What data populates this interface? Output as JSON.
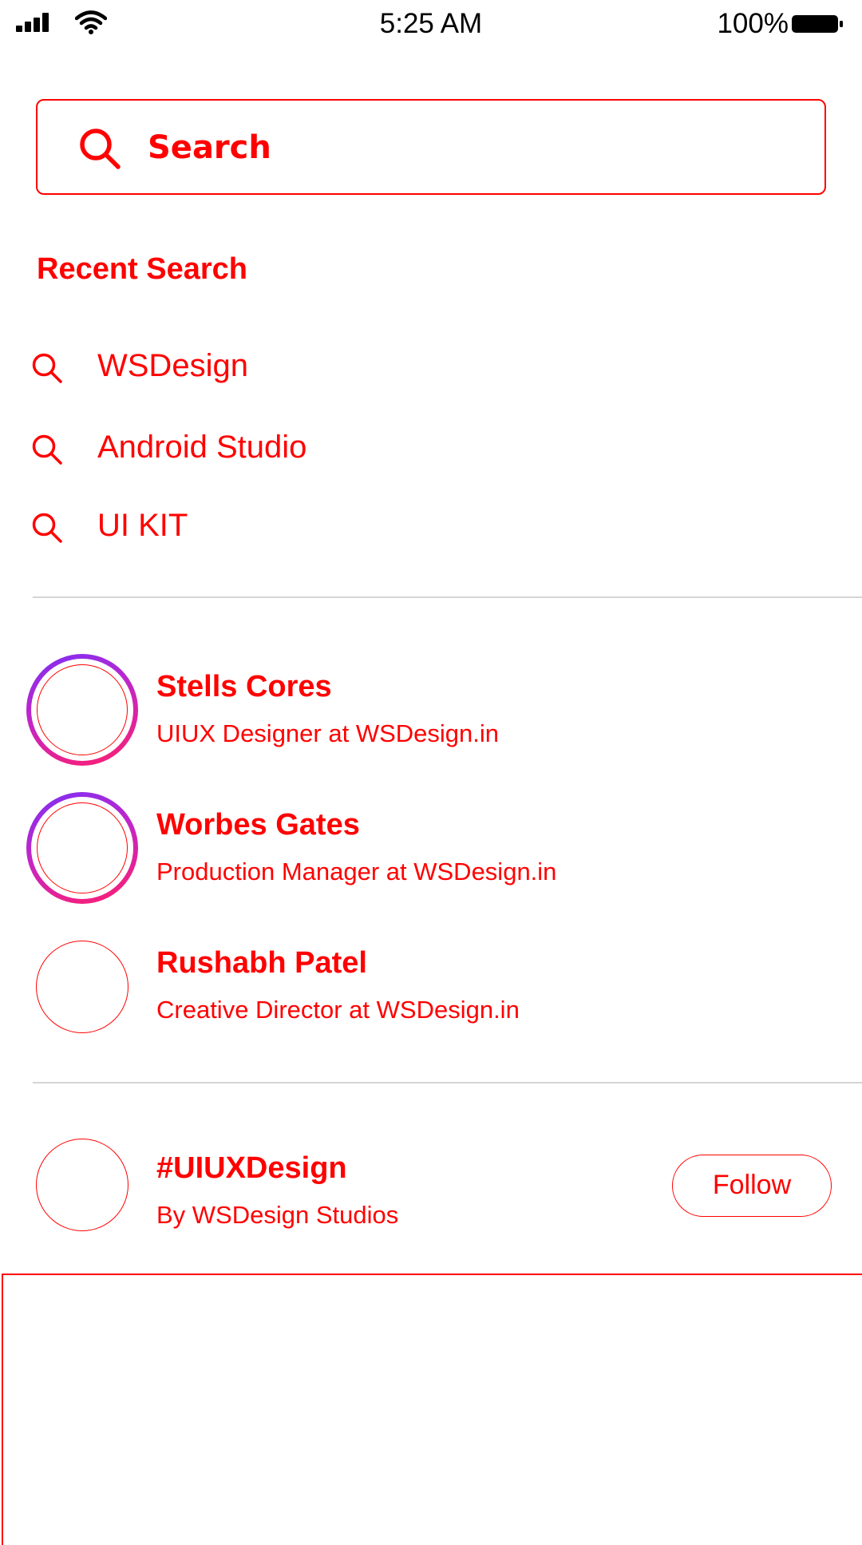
{
  "status_bar": {
    "time": "5:25 AM",
    "battery_percent": "100%",
    "icons": [
      "signal-icon",
      "wifi-icon",
      "battery-icon"
    ]
  },
  "search": {
    "placeholder": "Search",
    "value": ""
  },
  "recent": {
    "title": "Recent Search",
    "items": [
      {
        "label": "WSDesign"
      },
      {
        "label": "Android Studio"
      },
      {
        "label": "UI KIT"
      }
    ]
  },
  "people": [
    {
      "name": "Stells Cores",
      "role": "UIUX Designer at WSDesign.in",
      "story_ring": true
    },
    {
      "name": "Worbes Gates",
      "role": "Production Manager at WSDesign.in",
      "story_ring": true
    },
    {
      "name": "Rushabh Patel",
      "role": "Creative Director at WSDesign.in",
      "story_ring": false
    }
  ],
  "hashtag": {
    "name": "#UIUXDesign",
    "subtitle": "By WSDesign Studios",
    "follow_label": "Follow"
  },
  "colors": {
    "accent": "#ff0000",
    "divider": "#d4d4d4",
    "ring_start": "#7b2ff7",
    "ring_end": "#ff1f6b"
  }
}
